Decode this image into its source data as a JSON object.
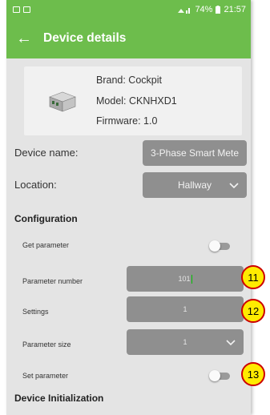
{
  "status_bar": {
    "battery": "74%",
    "time": "21:57"
  },
  "app_bar": {
    "title": "Device details"
  },
  "device": {
    "brand": "Brand: Cockpit",
    "model": "Model: CKNHXD1",
    "firmware": "Firmware: 1.0"
  },
  "fields": {
    "device_name_label": "Device name:",
    "device_name_value": "3-Phase Smart Mete",
    "location_label": "Location:",
    "location_value": "Hallway"
  },
  "configuration": {
    "heading": "Configuration",
    "get_parameter_label": "Get parameter",
    "get_parameter_on": false,
    "parameter_number_label": "Parameter number",
    "parameter_number_value": "101",
    "settings_label": "Settings",
    "settings_value": "1",
    "parameter_size_label": "Parameter size",
    "parameter_size_value": "1",
    "set_parameter_label": "Set parameter",
    "set_parameter_on": false
  },
  "device_initialization": {
    "heading": "Device Initialization"
  },
  "callouts": [
    "11",
    "12",
    "13"
  ],
  "colors": {
    "accent": "#6dbd4c",
    "field": "#8f8f8f",
    "callout_fill": "#ffeb00",
    "callout_border": "#cc0000"
  }
}
